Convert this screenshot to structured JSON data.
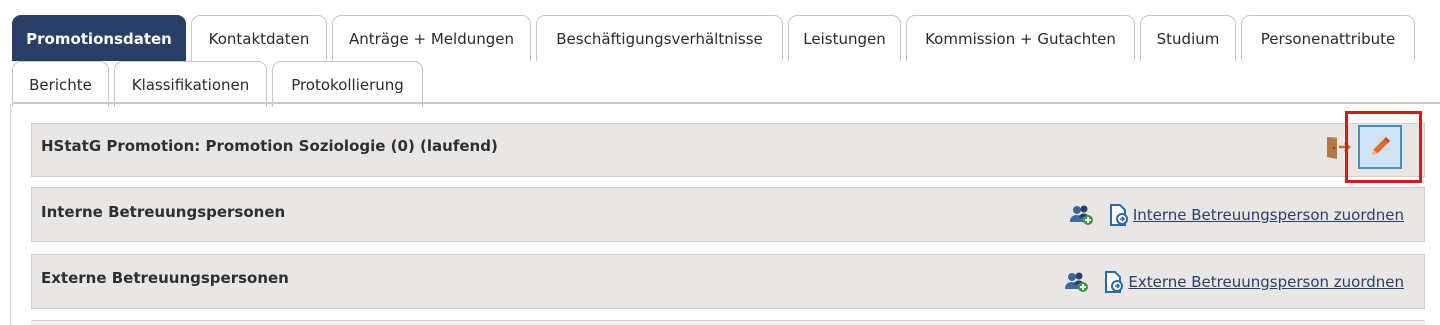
{
  "tabs_row1": [
    {
      "label": "Promotionsdaten",
      "active": true
    },
    {
      "label": "Kontaktdaten"
    },
    {
      "label": "Anträge + Meldungen"
    },
    {
      "label": "Beschäftigungsverhältnisse"
    },
    {
      "label": "Leistungen"
    },
    {
      "label": "Kommission + Gutachten"
    },
    {
      "label": "Studium"
    },
    {
      "label": "Personenattribute"
    }
  ],
  "tabs_row2": [
    {
      "label": "Berichte"
    },
    {
      "label": "Klassifikationen"
    },
    {
      "label": "Protokollierung"
    }
  ],
  "panels": {
    "promotion": {
      "title": "HStatG Promotion: Promotion Soziologie (0) (laufend)",
      "icons": [
        "exit-door-icon",
        "pencil-edit-icon"
      ]
    },
    "internal": {
      "title": "Interne Betreuungspersonen",
      "link": "Interne Betreuungsperson zuordnen",
      "icons": [
        "users-add-icon",
        "document-link-icon"
      ]
    },
    "external": {
      "title": "Externe Betreuungspersonen",
      "link": "Externe Betreuungsperson zuordnen",
      "icons": [
        "users-add-icon",
        "document-link-icon"
      ]
    }
  },
  "colors": {
    "active_tab": "#2b3f66",
    "panel_bg": "#e9e6e6",
    "edit_button": "#cfe3f3",
    "highlight": "#e0151b",
    "pencil": "#e8672a"
  }
}
